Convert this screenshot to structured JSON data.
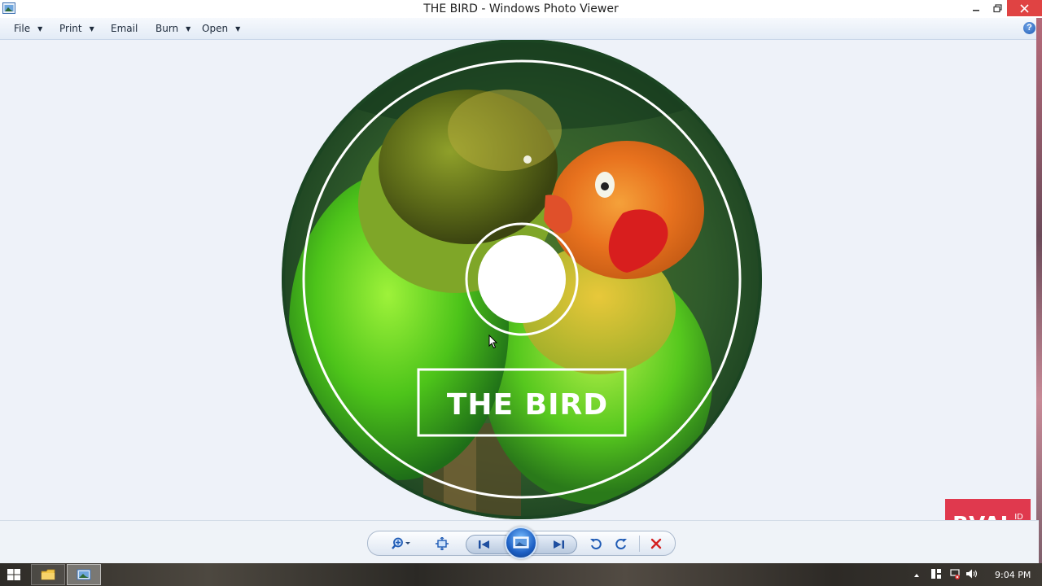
{
  "window": {
    "title": "THE BIRD - Windows Photo Viewer"
  },
  "menu": {
    "items": [
      {
        "label": "File",
        "has_dropdown": true
      },
      {
        "label": "Print",
        "has_dropdown": true
      },
      {
        "label": "Email",
        "has_dropdown": false
      },
      {
        "label": "Burn",
        "has_dropdown": true
      },
      {
        "label": "Open",
        "has_dropdown": true
      }
    ],
    "help_icon": "help-icon"
  },
  "image": {
    "disc_label": "THE BIRD",
    "content": "two lovebirds on a CD label"
  },
  "watermark": {
    "text": "RVAL",
    "superscript": "ID"
  },
  "toolbar": {
    "buttons": [
      "zoom-icon",
      "actual-size-icon",
      "previous-icon",
      "slideshow-icon",
      "next-icon",
      "rotate-counterclockwise-icon",
      "rotate-clockwise-icon",
      "delete-icon"
    ]
  },
  "taskbar": {
    "clock": "9:04 PM",
    "apps": [
      "file-explorer-icon",
      "photo-viewer-icon"
    ]
  },
  "colors": {
    "close_button": "#e04343",
    "viewer_bg": "#eef2f9",
    "watermark_bg": "#e0394e",
    "disc_dark_green": "#1e4a26"
  }
}
